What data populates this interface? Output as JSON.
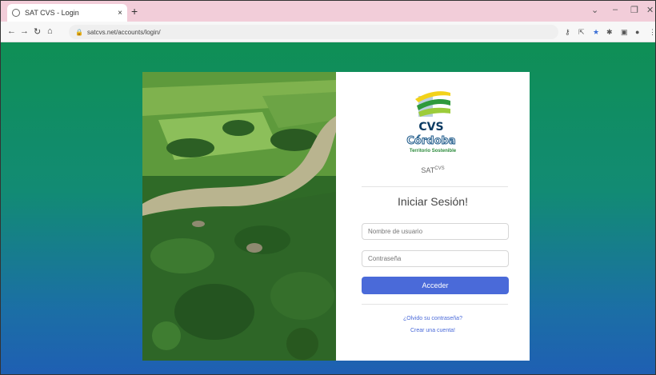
{
  "browser": {
    "tab_title": "SAT CVS - Login",
    "tab_close": "×",
    "new_tab": "+",
    "url": "satcvs.net/accounts/login/",
    "window_controls": [
      "⌄",
      "–",
      "❐",
      "✕"
    ]
  },
  "brand": {
    "logo_text": "CVS",
    "logo_subtext": "Córdoba",
    "tagline": "Territorio Sostenible",
    "app_name": "SAT",
    "app_name_sup": "CVS",
    "primary_color": "#4a6ad9"
  },
  "login": {
    "heading": "Iniciar Sesión!",
    "username_placeholder": "Nombre de usuario",
    "password_placeholder": "Contraseña",
    "submit_label": "Acceder",
    "forgot_password": "¿Olvido su contraseña?",
    "create_account": "Crear una cuenta!"
  }
}
